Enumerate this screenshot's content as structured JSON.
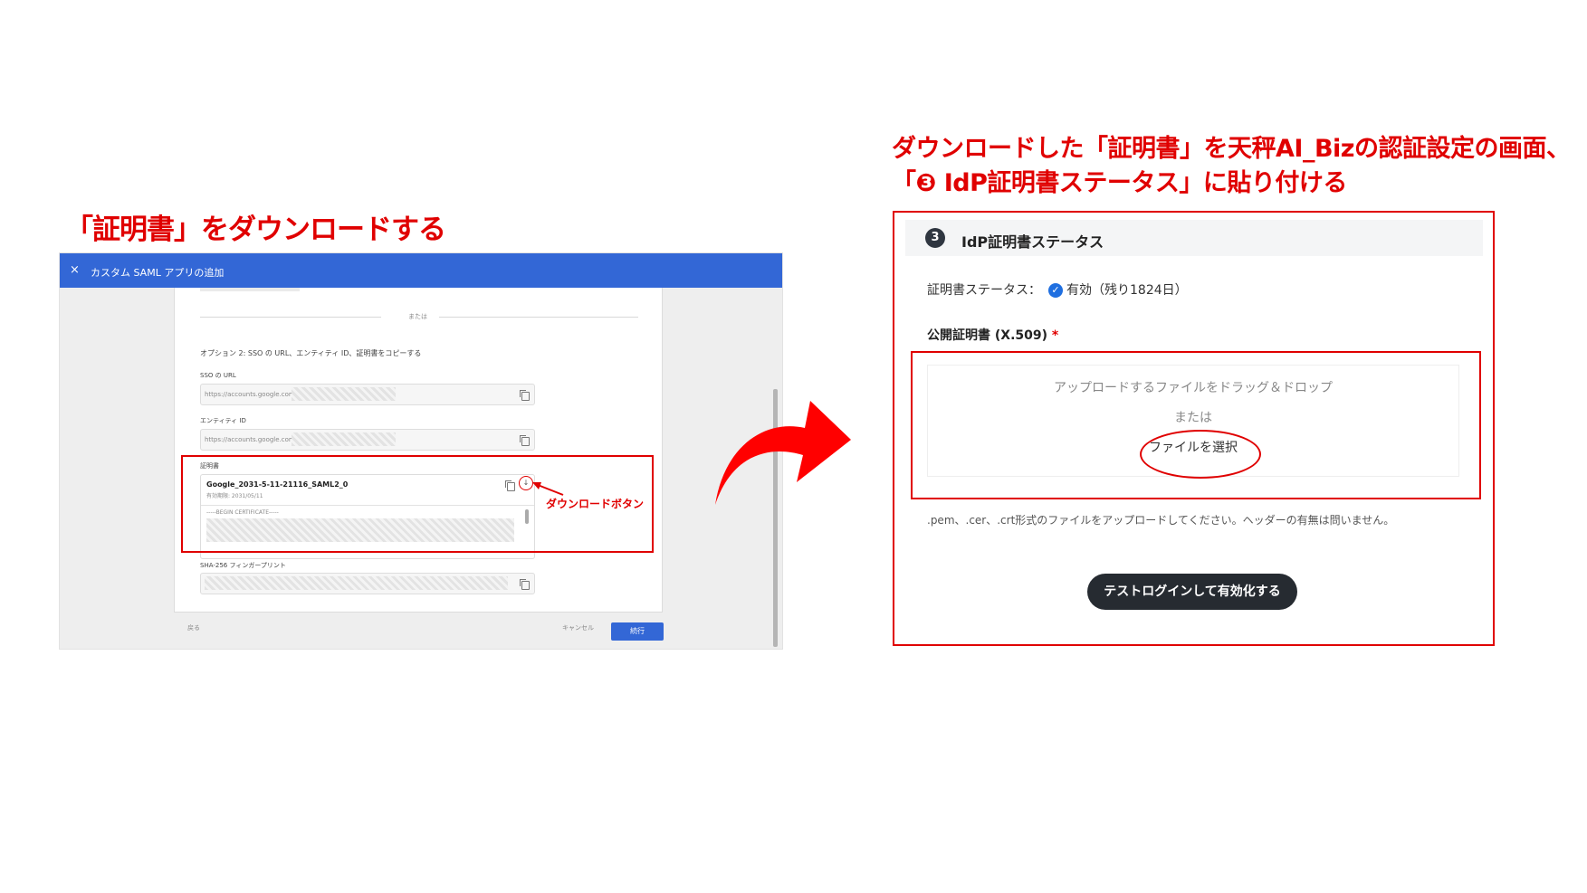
{
  "left_heading": "「証明書」をダウンロードする",
  "right_heading": {
    "line1": "ダウンロードした「証明書」を天秤AI_Bizの認証設定の画面、",
    "line2": "「❸ IdP証明書ステータス」に貼り付ける"
  },
  "left_screenshot": {
    "topbar": {
      "close_icon": "×",
      "title": "カスタム SAML アプリの追加"
    },
    "or_divider": "または",
    "option2": "オプション 2: SSO の URL、エンティティ ID、証明書をコピーする",
    "sso_url_label": "SSO の URL",
    "sso_url_value": "https://accounts.google.com/",
    "entity_id_label": "エンティティ ID",
    "entity_id_value": "https://accounts.google.com/",
    "cert_label": "証明書",
    "cert_name": "Google_2031-5-11-21116_SAML2_0",
    "cert_expiry": "有効期限: 2031/05/11",
    "cert_begin": "-----BEGIN CERTIFICATE-----",
    "sha_label": "SHA-256 フィンガープリント",
    "download_annotation": "ダウンロードボタン",
    "footer": {
      "back": "戻る",
      "cancel": "キャンセル",
      "continue": "続行"
    }
  },
  "right_panel": {
    "section_number": "3",
    "section_title": "IdP証明書ステータス",
    "status_label": "証明書ステータス：",
    "status_value": "有効（残り1824日）",
    "public_cert_label": "公開証明書 (X.509)",
    "required_mark": "*",
    "drop_text": "アップロードするファイルをドラッグ＆ドロップ",
    "or_text": "または",
    "select_file": "ファイルを選択",
    "hint": ".pem、.cer、.crt形式のファイルをアップロードしてください。ヘッダーの有無は問いません。",
    "test_login_button": "テストログインして有効化する"
  },
  "colors": {
    "accent_red": "#e00000",
    "google_blue": "#3367d6",
    "dark_button": "#262b31"
  }
}
